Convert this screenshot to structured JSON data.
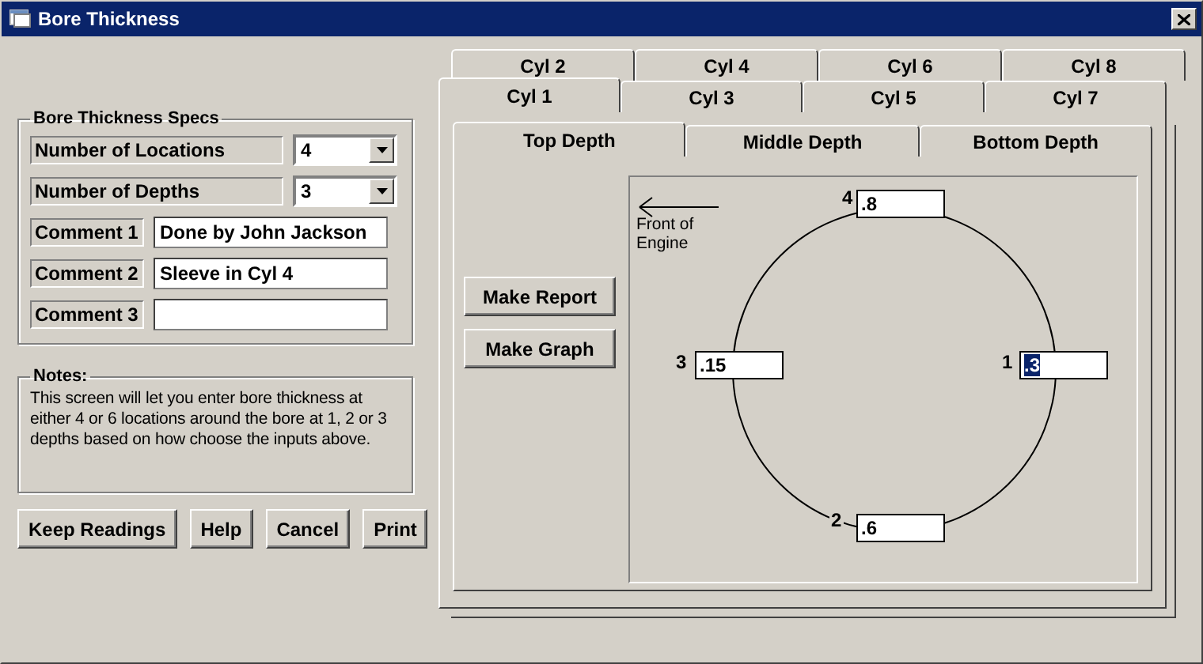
{
  "window": {
    "title": "Bore Thickness"
  },
  "specs": {
    "title": "Bore Thickness Specs",
    "fields": [
      {
        "kind": "dropdown",
        "label": "Number of Locations",
        "value": "4"
      },
      {
        "kind": "dropdown",
        "label": "Number of Depths",
        "value": "3"
      },
      {
        "kind": "text",
        "label": "Comment 1",
        "value": "Done by John Jackson"
      },
      {
        "kind": "text",
        "label": "Comment 2",
        "value": "Sleeve in Cyl 4"
      },
      {
        "kind": "text",
        "label": "Comment 3"
      }
    ]
  },
  "notes": {
    "title": "Notes:",
    "text": "This screen will let you enter bore thickness at either 4 or 6 locations around the bore at 1, 2 or 3 depths based on how choose the inputs above."
  },
  "buttons": [
    "Keep Readings",
    "Help",
    "Cancel",
    "Print"
  ],
  "cylinder_tabs": {
    "back_row": [
      {
        "label": "Cyl 2",
        "selected": false
      },
      {
        "label": "Cyl 4",
        "selected": false
      },
      {
        "label": "Cyl 6",
        "selected": false
      },
      {
        "label": "Cyl 8",
        "selected": false
      }
    ],
    "front_row": [
      {
        "label": "Cyl 1",
        "selected": true
      },
      {
        "label": "Cyl 3",
        "selected": false
      },
      {
        "label": "Cyl 5",
        "selected": false
      },
      {
        "label": "Cyl 7",
        "selected": false
      }
    ]
  },
  "depth_tabs": [
    {
      "label": "Top Depth",
      "selected": true
    },
    {
      "label": "Middle Depth",
      "selected": false
    },
    {
      "label": "Bottom Depth",
      "selected": false
    }
  ],
  "actions": [
    "Make Report",
    "Make Graph"
  ],
  "diagram": {
    "direction_label": "Front of Engine",
    "readings": [
      {
        "number": "1",
        "value": ".3",
        "highlighted": true
      },
      {
        "number": "2",
        "value": ".6",
        "highlighted": false
      },
      {
        "number": "3",
        "value": ".15",
        "highlighted": false
      },
      {
        "number": "4",
        "value": ".8",
        "highlighted": false
      }
    ]
  }
}
